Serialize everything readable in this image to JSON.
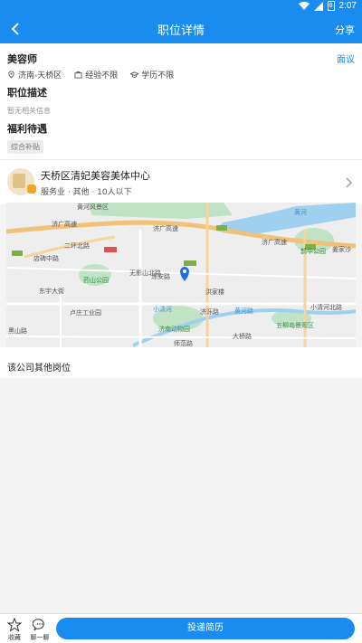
{
  "status": {
    "time": "2:07",
    "battery": "8"
  },
  "header": {
    "title": "职位详情",
    "share": "分享"
  },
  "job": {
    "title": "美容师",
    "interview_label": "面议",
    "location": "济南-天桥区",
    "experience": "经验不限",
    "education": "学历不限"
  },
  "sections": {
    "description_title": "职位描述",
    "description_text": "暂无相关信息",
    "benefits_title": "福利待遇",
    "benefit_tag": "综合补贴"
  },
  "company": {
    "name": "天桥区清妃美容美体中心",
    "info": "服务业 · 其他 · 10人以下"
  },
  "map": {
    "labels": [
      "黄河风景区",
      "济广高速",
      "济广高速",
      "济广高速",
      "黄河",
      "鹊华公园",
      "姜家沙",
      "二环北路",
      "店碑中路",
      "药山公园",
      "东宇大街",
      "卢庄工业园",
      "无影山北路",
      "洪家楼",
      "黄河路",
      "小清河",
      "济南动物园",
      "五柳岛景观区",
      "小清河北路",
      "黑山路",
      "济泺路",
      "泺安路",
      "师范路",
      "大桥路"
    ]
  },
  "other_positions": {
    "title": "该公司其他岗位"
  },
  "bottom": {
    "favorite": "收藏",
    "chat": "聊一聊",
    "apply": "投递简历"
  },
  "colors": {
    "primary": "#1a8cf0"
  }
}
